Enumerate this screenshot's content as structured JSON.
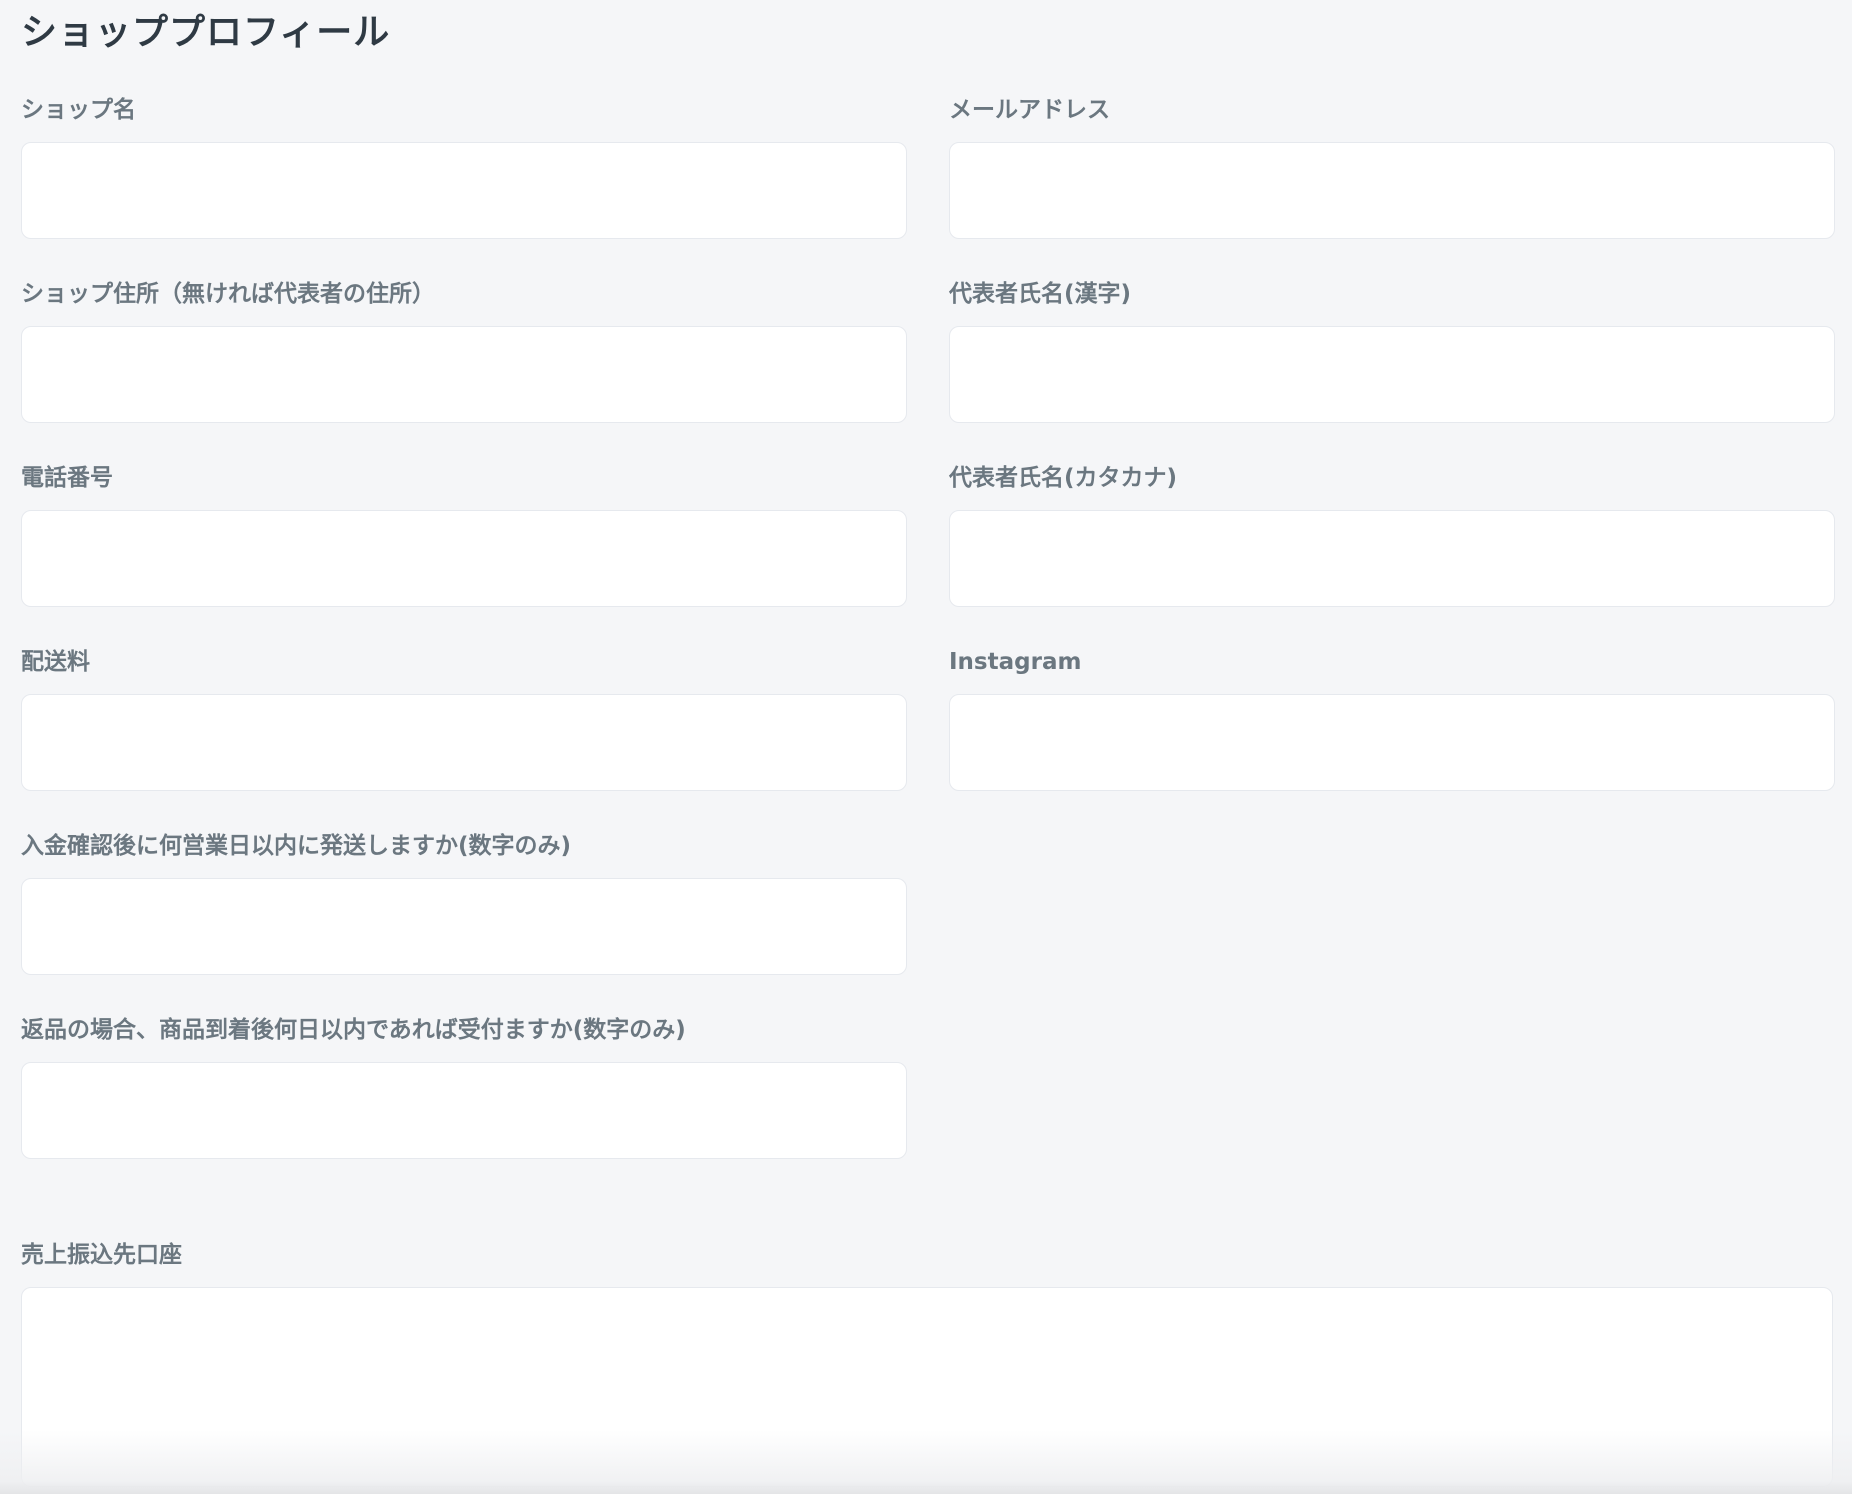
{
  "page": {
    "title": "ショッププロフィール"
  },
  "fields": {
    "shop_name": {
      "label": "ショップ名",
      "value": "",
      "placeholder": ""
    },
    "email": {
      "label": "メールアドレス",
      "value": "",
      "placeholder": ""
    },
    "shop_address": {
      "label": "ショップ住所（無ければ代表者の住所）",
      "value": "",
      "placeholder": ""
    },
    "rep_name_kanji": {
      "label": "代表者氏名(漢字)",
      "value": "",
      "placeholder": ""
    },
    "phone": {
      "label": "電話番号",
      "value": "",
      "placeholder": ""
    },
    "rep_name_katakana": {
      "label": "代表者氏名(カタカナ)",
      "value": "",
      "placeholder": ""
    },
    "shipping_fee": {
      "label": "配送料",
      "value": "",
      "placeholder": ""
    },
    "instagram": {
      "label": "Instagram",
      "value": "",
      "placeholder": ""
    },
    "ship_days": {
      "label": "入金確認後に何営業日以内に発送しますか(数字のみ)",
      "value": "",
      "placeholder": ""
    },
    "return_days": {
      "label": "返品の場合、商品到着後何日以内であれば受付ますか(数字のみ)",
      "value": "",
      "placeholder": ""
    },
    "bank_account": {
      "label": "売上振込先口座",
      "value": "",
      "placeholder": ""
    }
  }
}
